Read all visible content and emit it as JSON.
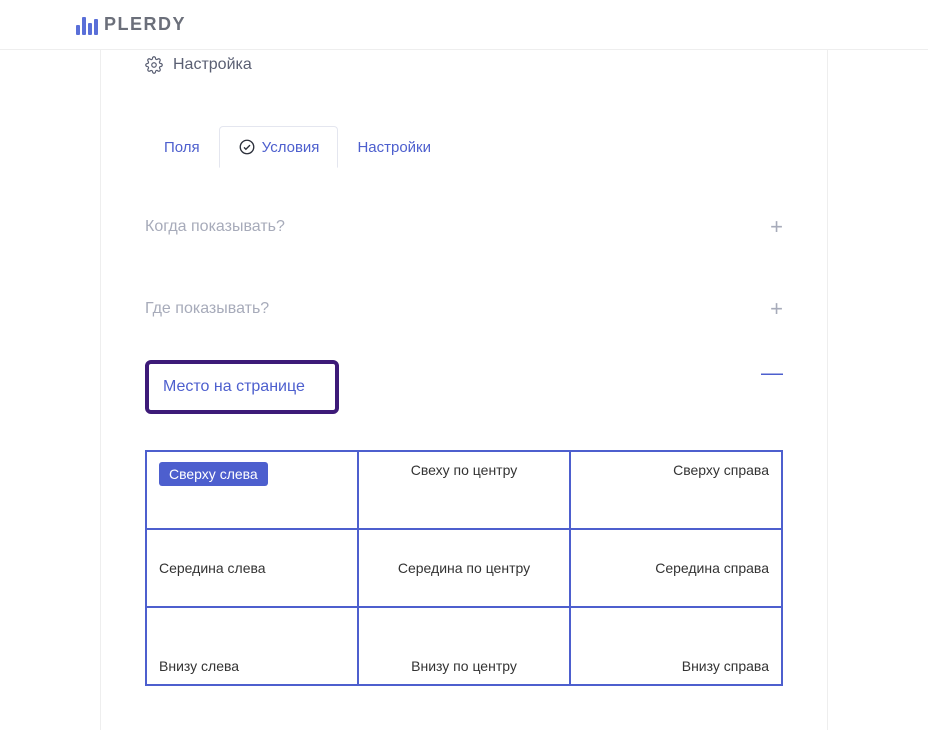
{
  "brand": "PLERDY",
  "breadcrumb": "Настройка",
  "tabs": {
    "fields": "Поля",
    "conditions": "Условия",
    "settings": "Настройки"
  },
  "sections": {
    "when": "Когда показывать?",
    "where": "Где показывать?",
    "position": "Место на странице"
  },
  "positions": {
    "tl": "Сверху слева",
    "tc": "Свеху по центру",
    "tr": "Сверху справа",
    "ml": "Середина слева",
    "mc": "Середина по центру",
    "mr": "Середина справа",
    "bl": "Внизу слева",
    "bc": "Внизу по центру",
    "br": "Внизу справа"
  }
}
